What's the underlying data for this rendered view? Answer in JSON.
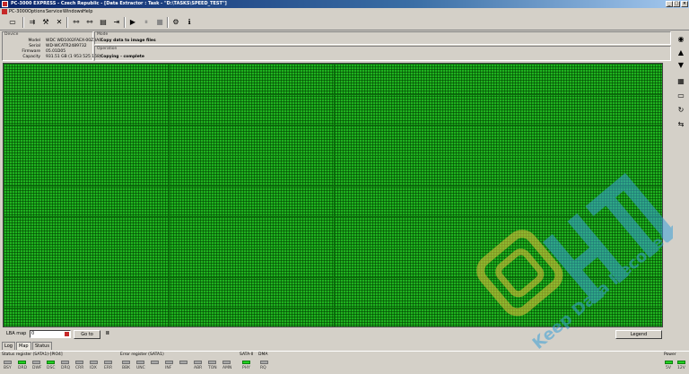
{
  "window": {
    "title": "PC-3000 EXPRESS - Czech Republic - [Data Extractor : Task - \"D:\\TASKS\\SPEED_TEST\"]"
  },
  "menu": [
    "PC-3000",
    "Options",
    "Service",
    "Windows",
    "Help"
  ],
  "device": {
    "label": "Device",
    "fields": [
      {
        "label": "Model",
        "value": "WDC WD1002FAEX-00Z3A0"
      },
      {
        "label": "Serial",
        "value": "WD-WCATR2489732"
      },
      {
        "label": "Firmware",
        "value": "05.01D05"
      },
      {
        "label": "Capacity",
        "value": "931.51 GB (1 953 525 168)"
      }
    ]
  },
  "mode": {
    "label": "Mode",
    "value": "Copy data to image files"
  },
  "operation": {
    "label": "Operation",
    "value": "Copying - complete"
  },
  "lba": {
    "label": "LBA map",
    "value": "0",
    "goto_label": "Go to",
    "pause_symbol": "II",
    "legend_label": "Legend"
  },
  "tabs": [
    "Log",
    "Map",
    "Status"
  ],
  "status_groups": {
    "status_register": "Status register (SATA1)-[PIO4]",
    "error_register": "Error register (SATA1)",
    "sata": "SATA-II",
    "dma": "DMA",
    "power": "Power"
  },
  "status_leds": [
    {
      "name": "BSY",
      "on": false
    },
    {
      "name": "DRD",
      "on": true
    },
    {
      "name": "DWF",
      "on": false
    },
    {
      "name": "DSC",
      "on": true
    },
    {
      "name": "DRQ",
      "on": false
    },
    {
      "name": "CRR",
      "on": false
    },
    {
      "name": "IDX",
      "on": false
    },
    {
      "name": "ERR",
      "on": false
    }
  ],
  "error_leds": [
    {
      "name": "BBK",
      "on": false
    },
    {
      "name": "UNC",
      "on": false
    },
    {
      "name": "",
      "on": false
    },
    {
      "name": "INF",
      "on": false
    },
    {
      "name": "",
      "on": false
    },
    {
      "name": "ABR",
      "on": false
    },
    {
      "name": "TON",
      "on": false
    },
    {
      "name": "AMN",
      "on": false
    }
  ],
  "sata_leds": [
    {
      "name": "PHY",
      "on": true
    }
  ],
  "dma_leds": [
    {
      "name": "RQ",
      "on": false
    }
  ],
  "power_leds": [
    {
      "name": "5V",
      "on": true
    },
    {
      "name": "12V",
      "on": true
    }
  ],
  "watermark": {
    "text": "HTI",
    "tagline": "Keep Data Recovery"
  },
  "colors": {
    "map_good": "#1fb21f",
    "led_on": "#22d022",
    "title_bar": "#0a246a"
  }
}
